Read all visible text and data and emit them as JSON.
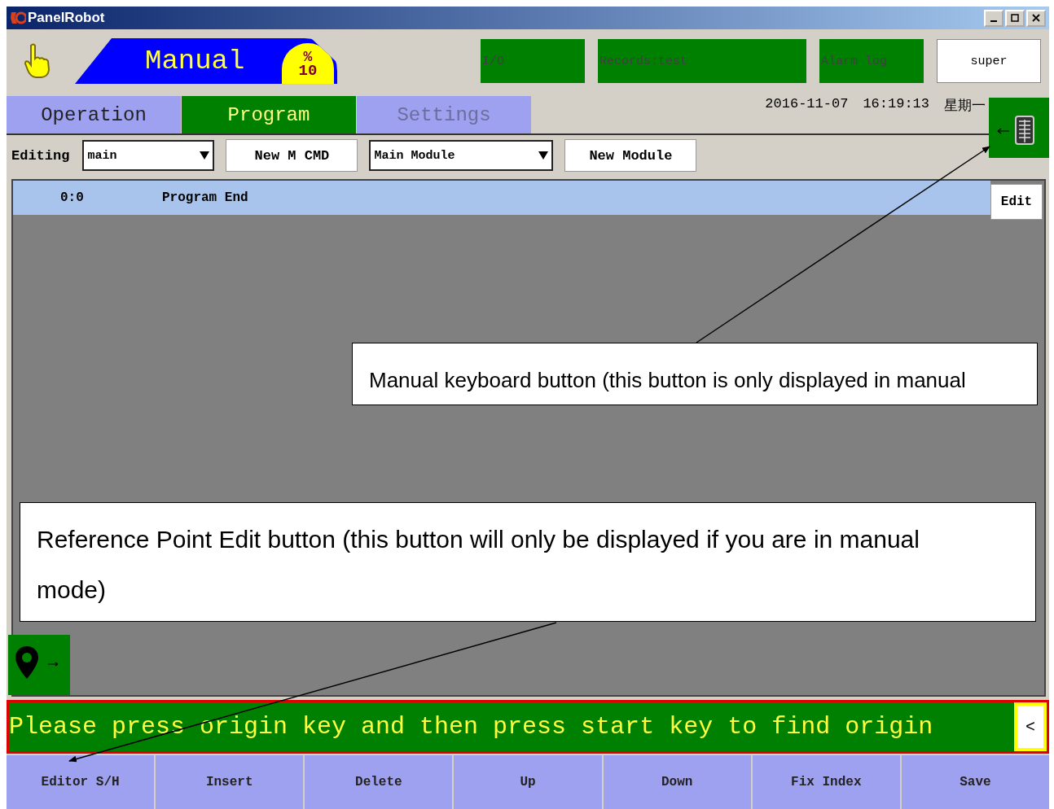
{
  "window": {
    "title": "PanelRobot"
  },
  "header": {
    "mode": "Manual",
    "speed_symbol": "%",
    "speed": "10",
    "buttons": [
      {
        "label": "I/O"
      },
      {
        "label": "Records:test"
      },
      {
        "label": "Alarm log"
      }
    ],
    "user": "super"
  },
  "tabs": [
    {
      "label": "Operation",
      "selected": false,
      "disabled": false
    },
    {
      "label": "Program",
      "selected": true,
      "disabled": false
    },
    {
      "label": "Settings",
      "selected": false,
      "disabled": true
    }
  ],
  "datetime": {
    "date": "2016-11-07",
    "time": "16:19:13",
    "weekday": "星期一"
  },
  "toolbar": {
    "label": "Editing",
    "program": "main",
    "new_cmd": "New M CMD",
    "module": "Main Module",
    "new_module": "New Module"
  },
  "program": {
    "rows": [
      {
        "index": "0:0",
        "text": "Program End",
        "selected": true
      }
    ],
    "edit_button": "Edit"
  },
  "message": {
    "text": "Please press origin key and then press start key to find origin",
    "collapse_glyph": "<"
  },
  "bottom_buttons": [
    "Editor S/H",
    "Insert",
    "Delete",
    "Up",
    "Down",
    "Fix Index",
    "Save"
  ],
  "annotations": [
    {
      "text": "Manual keyboard button (this button is only displayed in manual"
    },
    {
      "text": "Reference Point Edit button (this button will only be displayed if you are in manual mode)"
    }
  ]
}
